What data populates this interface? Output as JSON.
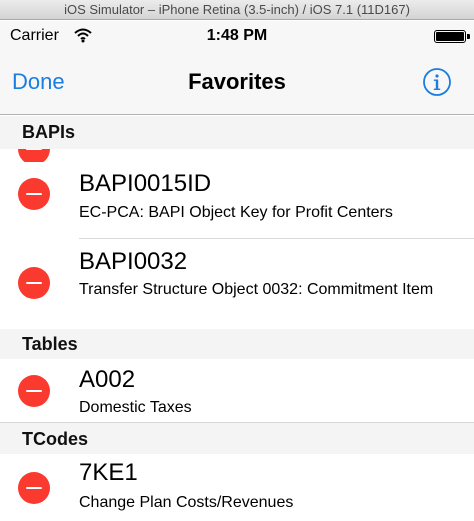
{
  "window": {
    "title": "iOS Simulator – iPhone Retina (3.5-inch) / iOS 7.1 (11D167)"
  },
  "status_bar": {
    "carrier": "Carrier",
    "time": "1:48 PM",
    "battery_icon": "battery-full-icon",
    "wifi_icon": "wifi-icon"
  },
  "nav": {
    "done_label": "Done",
    "title": "Favorites",
    "info_icon": "info-icon"
  },
  "accent_color": "#1a7de0",
  "delete_color": "#fb3a2f",
  "sections": [
    {
      "header": "BAPIs",
      "items": [
        {
          "title": "BAPI0015ID",
          "subtitle": "EC-PCA: BAPI Object Key for Profit Centers"
        },
        {
          "title": "BAPI0032",
          "subtitle": "Transfer Structure Object 0032: Commitment Item"
        }
      ]
    },
    {
      "header": "Tables",
      "items": [
        {
          "title": "A002",
          "subtitle": "Domestic Taxes"
        }
      ]
    },
    {
      "header": "TCodes",
      "items": [
        {
          "title": "7KE1",
          "subtitle": "Change Plan Costs/Revenues"
        }
      ]
    }
  ]
}
